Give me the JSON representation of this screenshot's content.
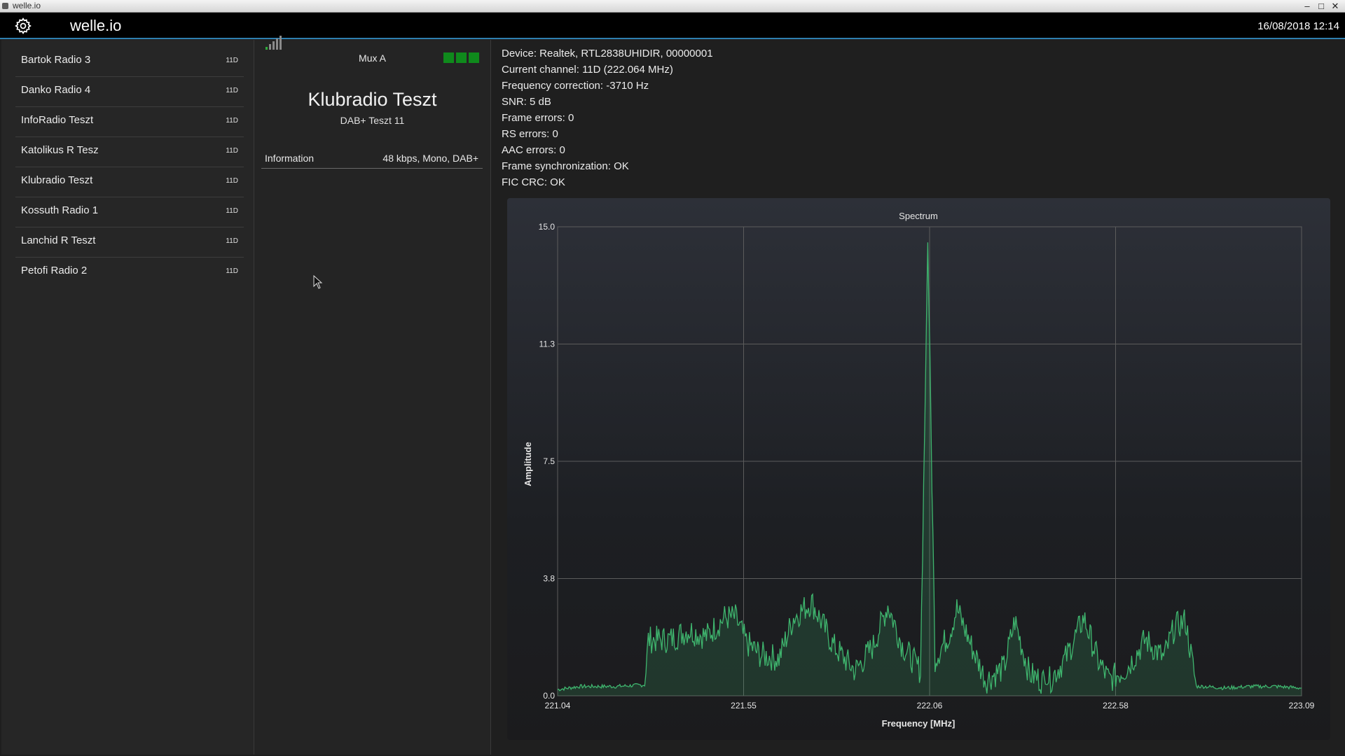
{
  "window": {
    "title": "welle.io"
  },
  "header": {
    "app_title": "welle.io",
    "datetime": "16/08/2018 12:14",
    "settings_icon": "gear-icon"
  },
  "stations": [
    {
      "name": "Bartok Radio 3",
      "channel": "11D"
    },
    {
      "name": "Danko Radio 4",
      "channel": "11D"
    },
    {
      "name": "InfoRadio Teszt",
      "channel": "11D"
    },
    {
      "name": "Katolikus R Tesz",
      "channel": "11D"
    },
    {
      "name": "Klubradio Teszt",
      "channel": "11D"
    },
    {
      "name": "Kossuth Radio 1",
      "channel": "11D"
    },
    {
      "name": "Lanchid R Teszt",
      "channel": "11D"
    },
    {
      "name": "Petofi Radio 2",
      "channel": "11D"
    }
  ],
  "now_playing": {
    "ensemble": "Mux A",
    "signal_level_bars": 1,
    "signal_max_bars": 5,
    "sync_indicators": 3,
    "station_name": "Klubradio Teszt",
    "station_sub": "DAB+ Teszt 11",
    "info_label": "Information",
    "info_value": "48 kbps, Mono, DAB+"
  },
  "device_info": {
    "device": "Device: Realtek, RTL2838UHIDIR, 00000001",
    "channel": "Current channel: 11D (222.064 MHz)",
    "freq_correction": "Frequency correction: -3710 Hz",
    "snr": "SNR: 5 dB",
    "frame_errors": "Frame errors: 0",
    "rs_errors": "RS errors: 0",
    "aac_errors": "AAC errors: 0",
    "frame_sync": "Frame synchronization: OK",
    "fic_crc": "FIC CRC: OK"
  },
  "colors": {
    "accent": "#2e7fb0",
    "spectrum": "#3fb56e",
    "sync_ok": "#0f8a1c"
  },
  "chart_data": {
    "type": "area",
    "title": "Spectrum",
    "xlabel": "Frequency [MHz]",
    "ylabel": "Amplitude",
    "xlim": [
      221.04,
      223.09
    ],
    "ylim": [
      0,
      15
    ],
    "x_ticks": [
      "221.04",
      "221.55",
      "222.06",
      "222.58",
      "223.09"
    ],
    "y_ticks": [
      "15.0",
      "11.3",
      "7.5",
      "3.8",
      "0.0"
    ],
    "grid": true,
    "series": [
      {
        "x": [
          221.04,
          221.1,
          221.2,
          221.28,
          221.29,
          221.35,
          221.4,
          221.45,
          221.5,
          221.53,
          221.56,
          221.6,
          221.65,
          221.69,
          221.74,
          221.8,
          221.86,
          221.91,
          221.95,
          221.99,
          222.04,
          222.06,
          222.08,
          222.12,
          222.14,
          222.18,
          222.22,
          222.27,
          222.3,
          222.34,
          222.39,
          222.44,
          222.49,
          222.53,
          222.56,
          222.61,
          222.66,
          222.71,
          222.74,
          222.77,
          222.8,
          222.82,
          222.88,
          222.95,
          223.02,
          223.09
        ],
        "y": [
          0.2,
          0.3,
          0.3,
          0.35,
          1.8,
          1.8,
          2.1,
          1.9,
          2.5,
          2.5,
          1.7,
          1.3,
          1.2,
          2.5,
          3.0,
          1.6,
          0.8,
          1.6,
          2.9,
          1.6,
          0.8,
          14.5,
          1.2,
          2.0,
          2.8,
          1.6,
          0.5,
          0.9,
          2.4,
          0.7,
          0.4,
          1.2,
          2.5,
          1.1,
          0.5,
          0.9,
          1.8,
          1.2,
          2.2,
          2.4,
          0.3,
          0.3,
          0.25,
          0.3,
          0.3,
          0.25
        ]
      }
    ]
  },
  "cursor_icon": "mouse-pointer-icon"
}
